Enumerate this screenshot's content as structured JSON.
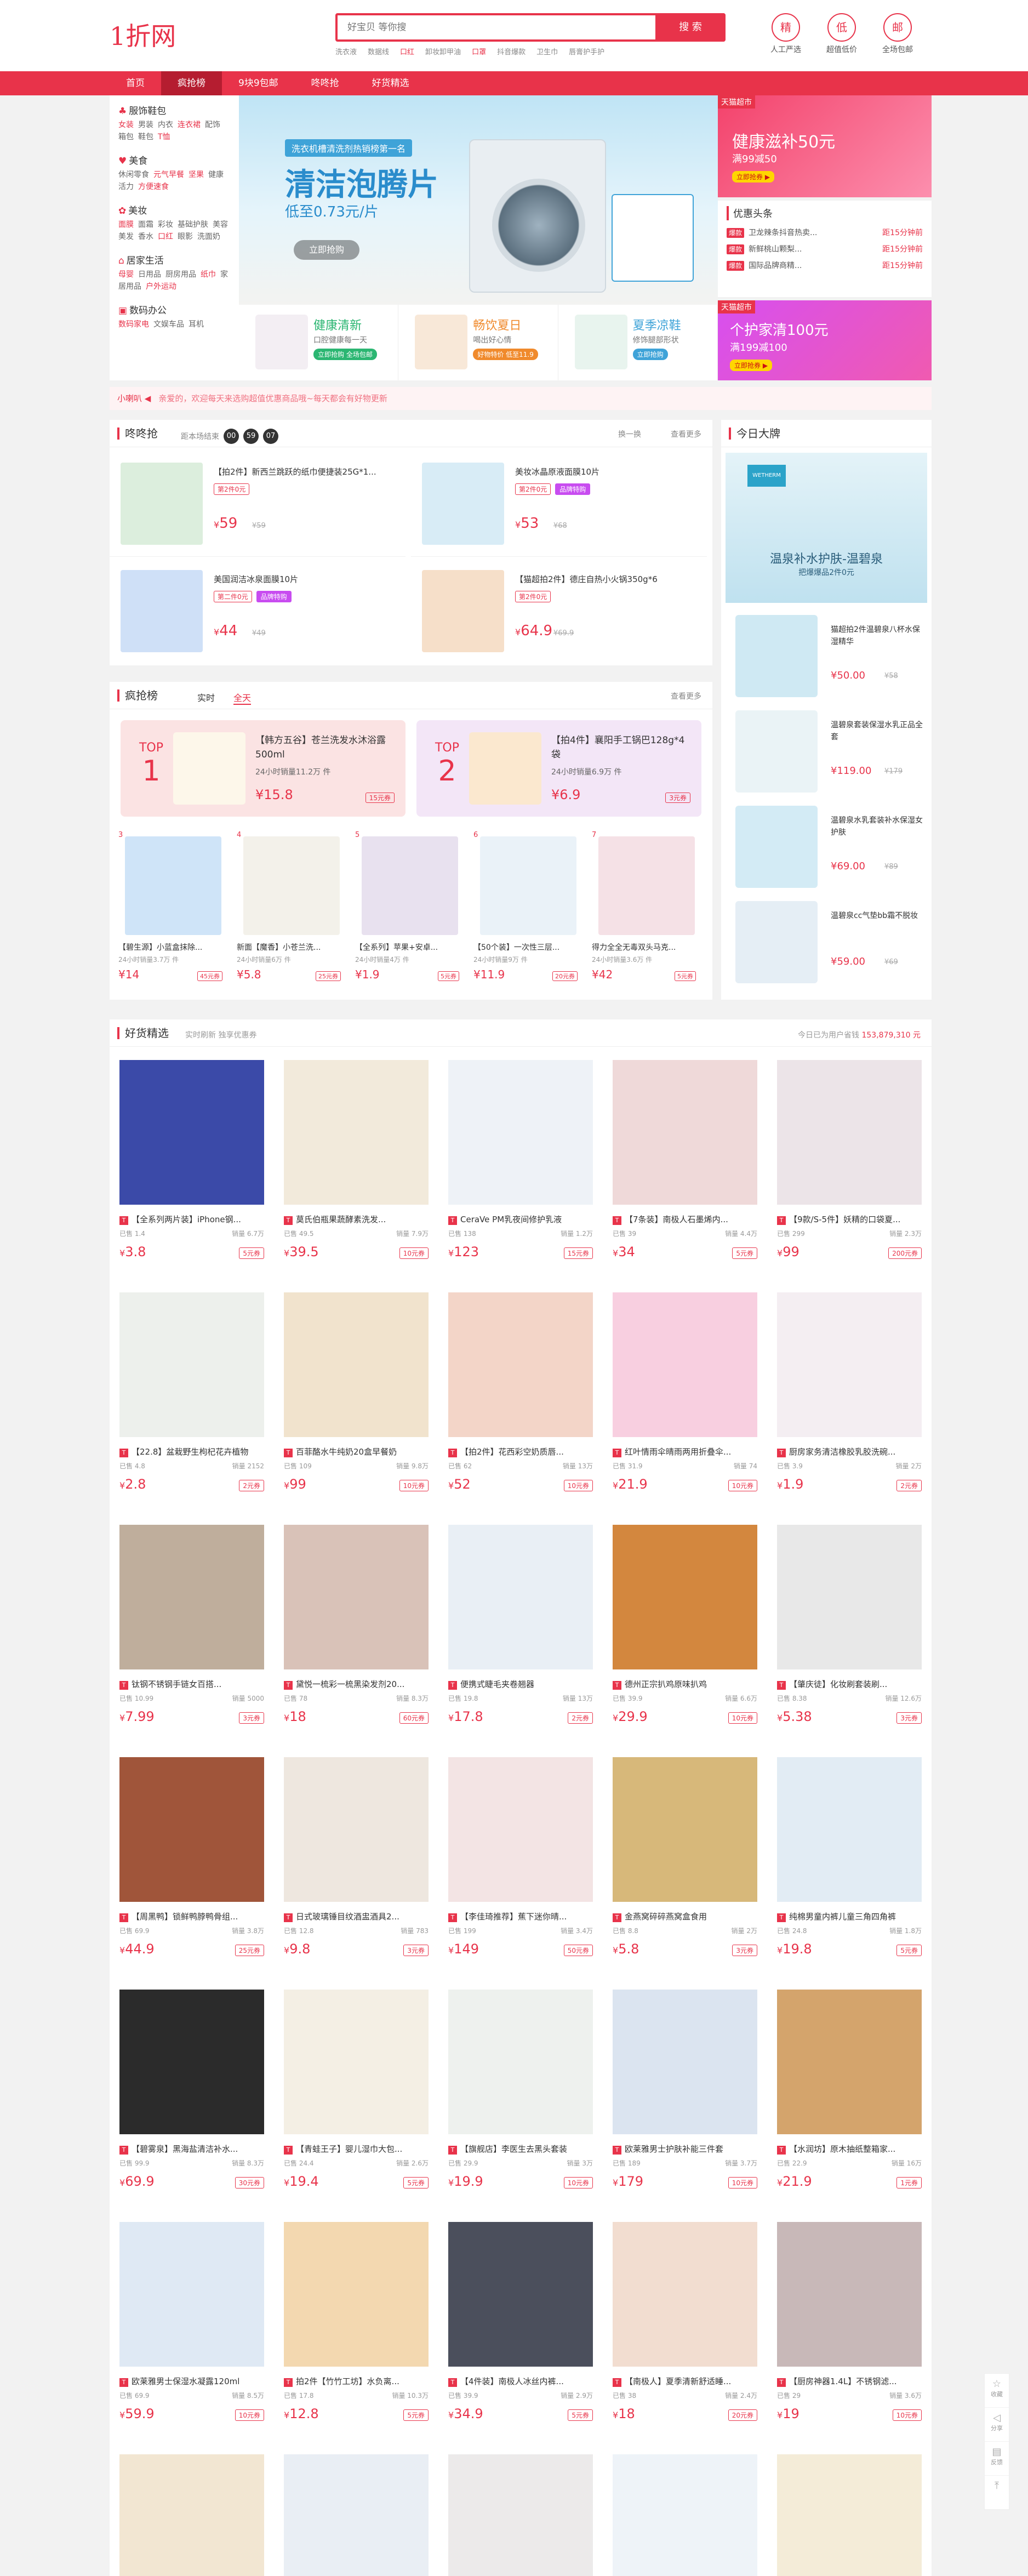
{
  "header": {
    "logo": "1折网",
    "search_placeholder": "好宝贝 等你搜",
    "search_button": "搜 索",
    "hotwords": [
      {
        "text": "洗衣液",
        "hot": false
      },
      {
        "text": "数据线",
        "hot": false
      },
      {
        "text": "口红",
        "hot": true
      },
      {
        "text": "卸妆卸甲油",
        "hot": false
      },
      {
        "text": "口罩",
        "hot": true
      },
      {
        "text": "抖音爆款",
        "hot": false
      },
      {
        "text": "卫生巾",
        "hot": false
      },
      {
        "text": "唇膏护手护",
        "hot": false
      }
    ],
    "icons": [
      {
        "glyph": "精",
        "label": "人工严选"
      },
      {
        "glyph": "低",
        "label": "超值低价"
      },
      {
        "glyph": "邮",
        "label": "全场包邮"
      }
    ]
  },
  "nav": {
    "items": [
      "首页",
      "疯抢榜",
      "9块9包邮",
      "咚咚抢",
      "好货精选"
    ],
    "active": 1
  },
  "categories": [
    {
      "icon": "♣",
      "title": "服饰鞋包",
      "links": [
        {
          "t": "女装",
          "r": true
        },
        {
          "t": "男装",
          "r": false
        },
        {
          "t": "内衣",
          "r": false
        },
        {
          "t": "连衣裙",
          "r": true
        },
        {
          "t": "配饰",
          "r": false
        },
        {
          "t": "箱包",
          "r": false
        },
        {
          "t": "鞋包",
          "r": false
        },
        {
          "t": "T恤",
          "r": true
        }
      ]
    },
    {
      "icon": "♥",
      "title": "美食",
      "links": [
        {
          "t": "休闲零食",
          "r": false
        },
        {
          "t": "元气早餐",
          "r": true
        },
        {
          "t": "坚果",
          "r": true
        },
        {
          "t": "健康活力",
          "r": false
        },
        {
          "t": "方便速食",
          "r": true
        }
      ]
    },
    {
      "icon": "✿",
      "title": "美妆",
      "links": [
        {
          "t": "面膜",
          "r": true
        },
        {
          "t": "面霜",
          "r": false
        },
        {
          "t": "彩妆",
          "r": false
        },
        {
          "t": "基础护肤",
          "r": false
        },
        {
          "t": "美容美发",
          "r": false
        },
        {
          "t": "香水",
          "r": false
        },
        {
          "t": "口红",
          "r": true
        },
        {
          "t": "眼影",
          "r": false
        },
        {
          "t": "洗面奶",
          "r": false
        }
      ]
    },
    {
      "icon": "⌂",
      "title": "居家生活",
      "links": [
        {
          "t": "母婴",
          "r": true
        },
        {
          "t": "日用品",
          "r": false
        },
        {
          "t": "厨房用品",
          "r": false
        },
        {
          "t": "纸巾",
          "r": true
        },
        {
          "t": "家居用品",
          "r": false
        },
        {
          "t": "户外运动",
          "r": true
        }
      ]
    },
    {
      "icon": "▣",
      "title": "数码办公",
      "links": [
        {
          "t": "数码家电",
          "r": true
        },
        {
          "t": "文娱车品",
          "r": false
        },
        {
          "t": "耳机",
          "r": false
        }
      ]
    }
  ],
  "banner": {
    "tag": "洗衣机槽清洗剂热销榜第一名",
    "title": "清洁泡腾片",
    "sub": "低至0.73元/片",
    "button": "立即抢购"
  },
  "mini_cards": [
    {
      "title": "健康清新",
      "sub": "口腔健康每一天",
      "badge": "立即抢购 全场包邮",
      "color": "#2bb672",
      "img": "#f3eef3"
    },
    {
      "title": "畅饮夏日",
      "sub": "喝出好心情",
      "badge": "好物特价 低至11.9",
      "color": "#f08a2c",
      "img": "#f8e8d8"
    },
    {
      "title": "夏季凉鞋",
      "sub": "修饰腿部形状",
      "badge": "立即抢购",
      "color": "#3fa3d8",
      "img": "#e8f4ee"
    }
  ],
  "ad_top": {
    "label": "天猫超市",
    "title": "健康滋补50元",
    "sub": "满99减50",
    "button": "立即抢券 ▶"
  },
  "youhui": {
    "title": "优惠头条",
    "rows": [
      {
        "tag": "爆款",
        "text": "卫龙辣条抖音热卖...",
        "time": "距15分钟前"
      },
      {
        "tag": "爆款",
        "text": "新鲜桃山颗梨...",
        "time": "距15分钟前"
      },
      {
        "tag": "爆款",
        "text": "国际品牌商精...",
        "time": "距15分钟前"
      }
    ]
  },
  "ad_bottom": {
    "label": "天猫超市",
    "title": "个护家清100元",
    "sub": "满199减100",
    "button": "立即抢券 ▶"
  },
  "notice": {
    "label": "小喇叭 ◀",
    "text": "亲爱的，欢迎每天来选购超值优惠商品哦~每天都会有好物更新"
  },
  "qiang": {
    "title": "咚咚抢",
    "timer_label": "距本场结束",
    "timer": [
      "00",
      "59",
      "07"
    ],
    "swap": "换一换",
    "more": "查看更多",
    "items": [
      {
        "name": "【拍2件】新西兰跳跃的纸巾便捷装25G*1...",
        "tags": [
          {
            "type": "o",
            "text": "第2件0元"
          }
        ],
        "price": "59",
        "orig": "¥59",
        "color": "#dceedd"
      },
      {
        "name": "美妆冰晶原液面膜10片",
        "tags": [
          {
            "type": "o",
            "text": "第2件0元"
          },
          {
            "type": "p",
            "text": "品牌特购"
          }
        ],
        "price": "53",
        "orig": "¥68",
        "color": "#d8ecf6"
      },
      {
        "name": "美国润洁冰泉面膜10片",
        "tags": [
          {
            "type": "o",
            "text": "第二件0元"
          },
          {
            "type": "p",
            "text": "品牌特购"
          }
        ],
        "price": "44",
        "orig": "¥49",
        "color": "#cfe0f7"
      },
      {
        "name": "【猫超拍2件】德庄自热小火锅350g*6",
        "tags": [
          {
            "type": "o",
            "text": "第2件0元"
          }
        ],
        "price": "64.9",
        "orig": "¥69.9",
        "color": "#f6dfc9"
      }
    ]
  },
  "rank": {
    "title": "疯抢榜",
    "tabs": [
      "实时",
      "全天"
    ],
    "active_tab": 1,
    "more": "查看更多",
    "top": [
      {
        "label": "TOP",
        "no": "1",
        "name": "【韩方五谷】苍兰洗发水沐浴露500ml",
        "sold": "24小时销量11.2万 件",
        "price": "¥15.8",
        "coupon": "15元券",
        "bg": "#fbe3e3",
        "img": "#fdf7ea"
      },
      {
        "label": "TOP",
        "no": "2",
        "name": "【拍4件】襄阳手工锅巴128g*4袋",
        "sold": "24小时销量6.9万 件",
        "price": "¥6.9",
        "coupon": "3元券",
        "bg": "#f3e6f7",
        "img": "#fbe8cf"
      }
    ],
    "items": [
      {
        "no": "3",
        "name": "【碧生源】小蓝盒抹除...",
        "sold": "24小时销量3.7万 件",
        "price": "¥14",
        "coupon": "45元券",
        "color": "#cfe4f8"
      },
      {
        "no": "4",
        "name": "新面【魔香】小苍兰洗...",
        "sold": "24小时销量6万 件",
        "price": "¥5.8",
        "coupon": "25元券",
        "color": "#f3f1ea"
      },
      {
        "no": "5",
        "name": "【全系列】苹果+安卓...",
        "sold": "24小时销量4万 件",
        "price": "¥1.9",
        "coupon": "5元券",
        "color": "#e8e1ef"
      },
      {
        "no": "6",
        "name": "【50个装】一次性三层...",
        "sold": "24小时销量9万 件",
        "price": "¥11.9",
        "coupon": "20元券",
        "color": "#eaf2f8"
      },
      {
        "no": "7",
        "name": "得力全全无毒双头马克...",
        "sold": "24小时销量3.6万 件",
        "price": "¥42",
        "coupon": "5元券",
        "color": "#f5e1e6"
      }
    ]
  },
  "brand": {
    "title": "今日大牌",
    "hero_logo": "WETHERM",
    "hero_title": "温泉补水护肤-温碧泉",
    "hero_sub": "把爆爆品2件0元",
    "items": [
      {
        "name": "猫超拍2件温碧泉八杯水保湿精华",
        "price": "¥50.00",
        "orig": "¥58",
        "color": "#cfe9f3"
      },
      {
        "name": "温碧泉套装保湿水乳正品全套",
        "price": "¥119.00",
        "orig": "¥179",
        "color": "#eaf3f6"
      },
      {
        "name": "温碧泉水乳套装补水保湿女护肤",
        "price": "¥69.00",
        "orig": "¥89",
        "color": "#d3ebf5"
      },
      {
        "name": "温碧泉cc气垫bb霜不脱妆",
        "price": "¥59.00",
        "orig": "¥69",
        "color": "#e5eef5"
      }
    ]
  },
  "good": {
    "title": "好货精选",
    "sub": "实时刷新 独享优惠券",
    "note_label": "今日已为用户省钱",
    "note_value": "153,879,310 元",
    "items": [
      {
        "name": "【全系列两片装】iPhone钢...",
        "left": "已售 1.4",
        "right": "销量 6.7万",
        "price": "3.8",
        "coupon": "5元券",
        "color": "#3b4aa8"
      },
      {
        "name": "莫氏伯瓶果蔬酵素洗发...",
        "left": "已售 49.5",
        "right": "销量 7.9万",
        "price": "39.5",
        "coupon": "10元券",
        "color": "#f2eadb"
      },
      {
        "name": "CeraVe PM乳夜间修护乳液",
        "left": "已售 138",
        "right": "销量 1.2万",
        "price": "123",
        "coupon": "15元券",
        "color": "#eef2f7"
      },
      {
        "name": "【7条装】南极人石墨烯内...",
        "left": "已售 39",
        "right": "销量 4.4万",
        "price": "34",
        "coupon": "5元券",
        "color": "#efd9d9"
      },
      {
        "name": "【9款/S-5件】妖精的口袋夏...",
        "left": "已售 299",
        "right": "销量 2.3万",
        "price": "99",
        "coupon": "200元券",
        "color": "#ece4e8"
      },
      {
        "name": "【22.8】盆栽野生枸杞花卉植物",
        "left": "已售 4.8",
        "right": "销量 2152",
        "price": "2.8",
        "coupon": "2元券",
        "color": "#edf0ec"
      },
      {
        "name": "百菲酪水牛纯奶20盒早餐奶",
        "left": "已售 109",
        "right": "销量 9.8万",
        "price": "99",
        "coupon": "10元券",
        "color": "#f1e3cd"
      },
      {
        "name": "【拍2件】花西彩空奶质唇...",
        "left": "已售 62",
        "right": "销量 13万",
        "price": "52",
        "coupon": "10元券",
        "color": "#f3d5c8"
      },
      {
        "name": "红叶情雨伞晴雨两用折叠伞...",
        "left": "已售 31.9",
        "right": "销量 74",
        "price": "21.9",
        "coupon": "10元券",
        "color": "#f8cfe0"
      },
      {
        "name": "厨房家务清洁橡胶乳胶洗碗...",
        "left": "已售 3.9",
        "right": "销量 2万",
        "price": "1.9",
        "coupon": "2元券",
        "color": "#f4eef2"
      },
      {
        "name": "钛钢不锈钢手链女百搭...",
        "left": "已售 10.99",
        "right": "销量 5000",
        "price": "7.99",
        "coupon": "3元券",
        "color": "#bfae9c"
      },
      {
        "name": "黛悦一梳彩一梳黑染发剂20...",
        "left": "已售 78",
        "right": "销量 8.3万",
        "price": "18",
        "coupon": "60元券",
        "color": "#d9c2b8"
      },
      {
        "name": "便携式睫毛夹卷翘器",
        "left": "已售 19.8",
        "right": "销量 13万",
        "price": "17.8",
        "coupon": "2元券",
        "color": "#e9eff5"
      },
      {
        "name": "德州正宗扒鸡原味扒鸡",
        "left": "已售 39.9",
        "right": "销量 6.6万",
        "price": "29.9",
        "coupon": "10元券",
        "color": "#d3873e"
      },
      {
        "name": "【肇庆徒】化妆刷套装刷...",
        "left": "已售 8.38",
        "right": "销量 12.6万",
        "price": "5.38",
        "coupon": "3元券",
        "color": "#e8e8e8"
      },
      {
        "name": "【周黑鸭】锁鲜鸭脖鸭骨组...",
        "left": "已售 69.9",
        "right": "销量 3.8万",
        "price": "44.9",
        "coupon": "25元券",
        "color": "#a0553a"
      },
      {
        "name": "日式玻璃锤目纹酒盅酒具2...",
        "left": "已售 12.8",
        "right": "销量 783",
        "price": "9.8",
        "coupon": "3元券",
        "color": "#eee7df"
      },
      {
        "name": "【李佳琦推荐】蕉下迷你晴...",
        "left": "已售 199",
        "right": "销量 3.4万",
        "price": "149",
        "coupon": "50元券",
        "color": "#f3e4e4"
      },
      {
        "name": "金燕窝碎碎燕窝盒食用",
        "left": "已售 8.8",
        "right": "销量 2万",
        "price": "5.8",
        "coupon": "3元券",
        "color": "#d7b87a"
      },
      {
        "name": "纯棉男童内裤儿童三角四角裤",
        "left": "已售 24.8",
        "right": "销量 1.8万",
        "price": "19.8",
        "coupon": "5元券",
        "color": "#e2ecf4"
      },
      {
        "name": "【碧雾泉】黑海盐清洁补水...",
        "left": "已售 99.9",
        "right": "销量 8.3万",
        "price": "69.9",
        "coupon": "30元券",
        "color": "#2b2b2b"
      },
      {
        "name": "【青蛙王子】婴儿湿巾大包...",
        "left": "已售 24.4",
        "right": "销量 2.6万",
        "price": "19.4",
        "coupon": "5元券",
        "color": "#f4efe4"
      },
      {
        "name": "【旗舰店】李医生去黑头套装",
        "left": "已售 29.9",
        "right": "销量 3万",
        "price": "19.9",
        "coupon": "10元券",
        "color": "#eef1ee"
      },
      {
        "name": "欧莱雅男士护肤补能三件套",
        "left": "已售 189",
        "right": "销量 3.7万",
        "price": "179",
        "coupon": "10元券",
        "color": "#dbe4f0"
      },
      {
        "name": "【水润坊】原木抽纸整箱家...",
        "left": "已售 22.9",
        "right": "销量 16万",
        "price": "21.9",
        "coupon": "1元券",
        "color": "#d4a46c"
      },
      {
        "name": "欧莱雅男士保湿水凝露120ml",
        "left": "已售 69.9",
        "right": "销量 8.5万",
        "price": "59.9",
        "coupon": "10元券",
        "color": "#dfe9f4"
      },
      {
        "name": "拍2件【竹竹工坊】水负离...",
        "left": "已售 17.8",
        "right": "销量 10.3万",
        "price": "12.8",
        "coupon": "5元券",
        "color": "#f3d8b0"
      },
      {
        "name": "【4件装】南极人冰丝内裤...",
        "left": "已售 39.9",
        "right": "销量 2.9万",
        "price": "34.9",
        "coupon": "5元券",
        "color": "#4b4f5c"
      },
      {
        "name": "【南极人】夏季清新舒适睡...",
        "left": "已售 38",
        "right": "销量 2.4万",
        "price": "18",
        "coupon": "20元券",
        "color": "#f2ddd0"
      },
      {
        "name": "【厨房神器1.4L】不锈钢滤...",
        "left": "已售 29",
        "right": "销量 3.6万",
        "price": "19",
        "coupon": "10元券",
        "color": "#c8b8b8"
      },
      {
        "name": "",
        "left": "",
        "right": "",
        "price": "",
        "coupon": "",
        "color": "#f2e6d2"
      },
      {
        "name": "",
        "left": "",
        "right": "",
        "price": "",
        "coupon": "",
        "color": "#e9eef4"
      },
      {
        "name": "",
        "left": "",
        "right": "",
        "price": "",
        "coupon": "",
        "color": "#eceaea"
      },
      {
        "name": "",
        "left": "",
        "right": "",
        "price": "",
        "coupon": "",
        "color": "#eef3f8"
      },
      {
        "name": "",
        "left": "",
        "right": "",
        "price": "",
        "coupon": "",
        "color": "#f4ecd8"
      }
    ]
  },
  "side": [
    {
      "icon": "☆",
      "label": "收藏"
    },
    {
      "icon": "◁",
      "label": "分享"
    },
    {
      "icon": "▤",
      "label": "反馈"
    },
    {
      "icon": "⤒",
      "label": ""
    }
  ]
}
